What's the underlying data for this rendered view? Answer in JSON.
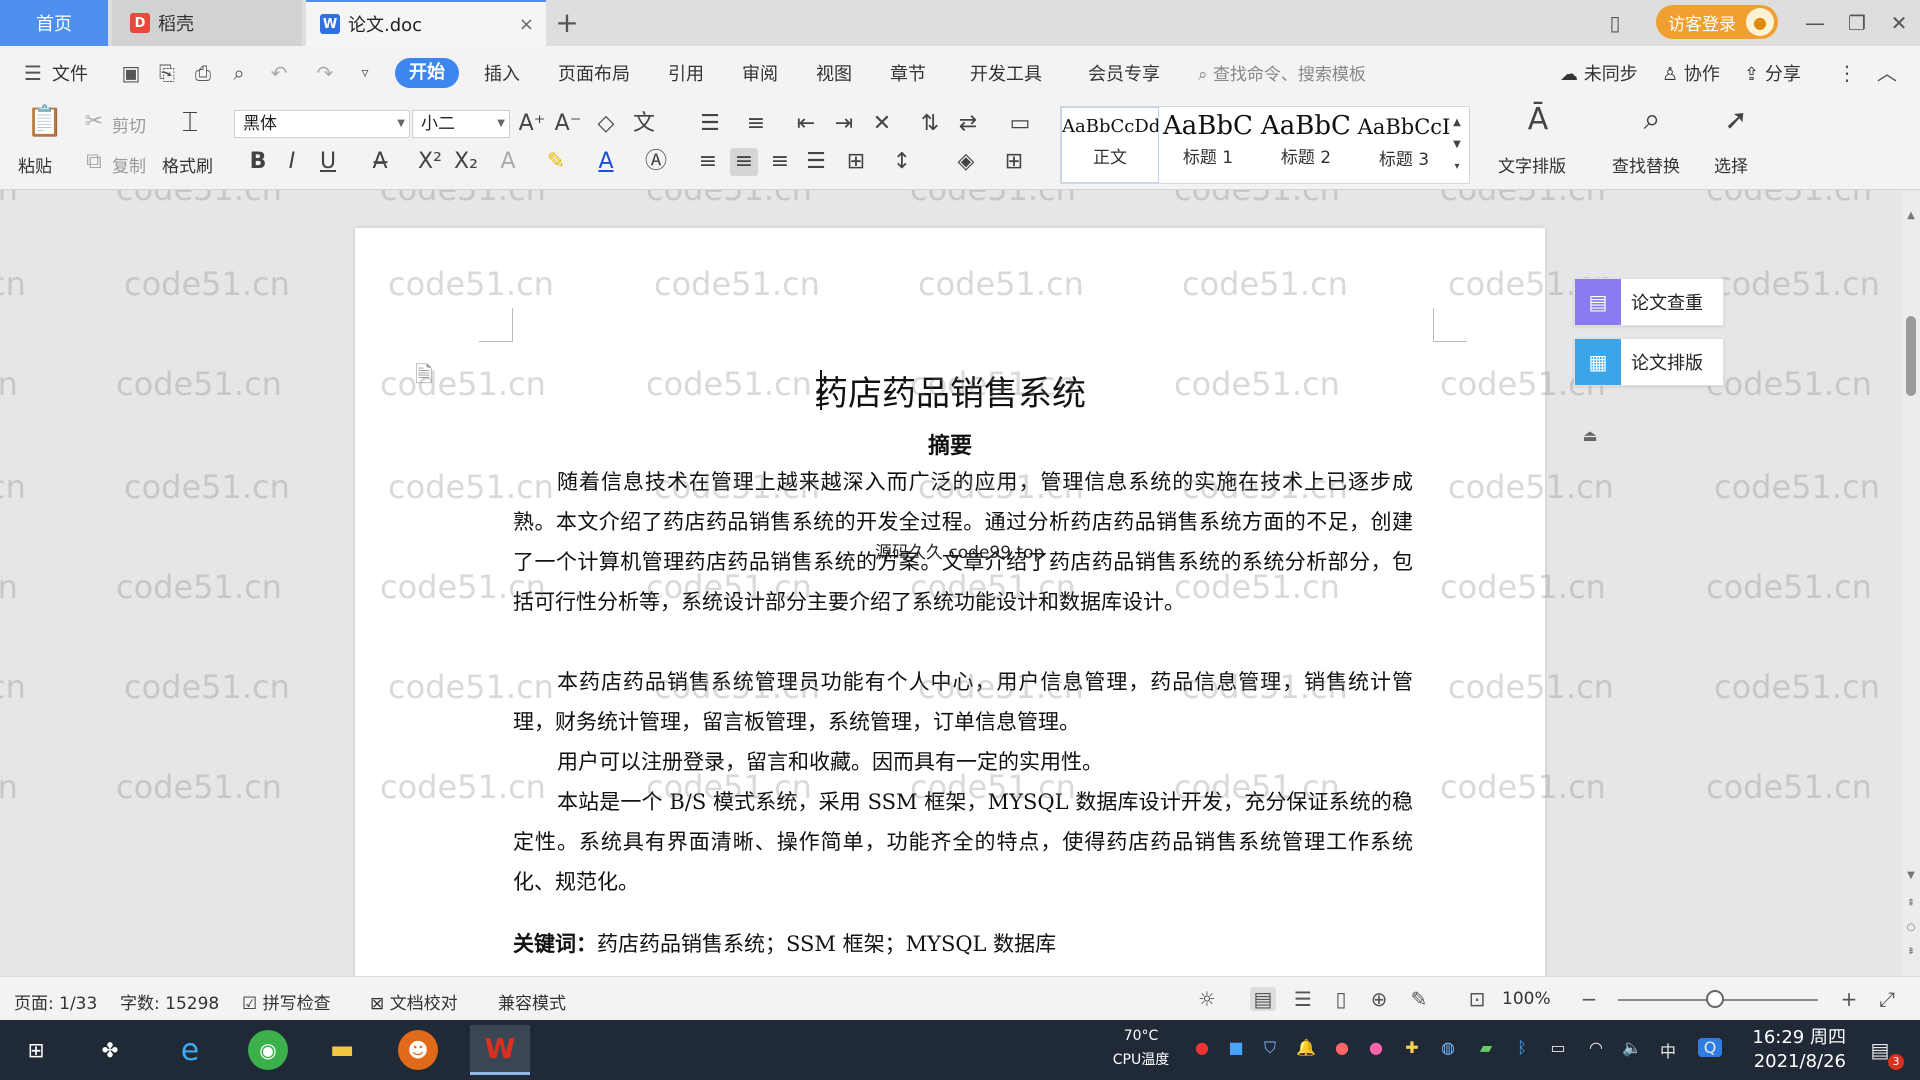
{
  "tabs": {
    "home": "首页",
    "daoke": "稻壳",
    "doc": "论文.doc",
    "add": "+",
    "close": "×"
  },
  "titlebar": {
    "guest_login": "访客登录",
    "minimize": "—",
    "restore": "❐",
    "close": "✕"
  },
  "menu": {
    "file": "文件",
    "start": "开始",
    "insert": "插入",
    "layout": "页面布局",
    "reference": "引用",
    "review": "审阅",
    "view": "视图",
    "chapter": "章节",
    "devtools": "开发工具",
    "vip": "会员专享",
    "search_placeholder": "查找命令、搜索模板",
    "unsynced": "未同步",
    "collab": "协作",
    "share": "分享"
  },
  "ribbon": {
    "paste": "粘贴",
    "cut": "剪切",
    "copy": "复制",
    "format_painter": "格式刷",
    "font_name": "黑体",
    "font_size": "小二",
    "styles": [
      {
        "sample": "AaBbCcDd",
        "name": "正文"
      },
      {
        "sample": "AaBbC",
        "name": "标题 1"
      },
      {
        "sample": "AaBbC",
        "name": "标题 2"
      },
      {
        "sample": "AaBbCcI",
        "name": "标题 3"
      }
    ],
    "text_layout": "文字排版",
    "find_replace": "查找替换",
    "select": "选择"
  },
  "document": {
    "title": "药店药品销售系统",
    "abstract_heading": "摘要",
    "paragraphs": [
      "随着信息技术在管理上越来越深入而广泛的应用，管理信息系统的实施在技术上已逐步成熟。本文介绍了药店药品销售系统的开发全过程。通过分析药店药品销售系统方面的不足，创建了一个计算机管理药店药品销售系统的方案。文章介绍了药店药品销售系统的系统分析部分，包括可行性分析等，系统设计部分主要介绍了系统功能设计和数据库设计。",
      "本药店药品销售系统管理员功能有个人中心，用户信息管理，药品信息管理，销售统计管理，财务统计管理，留言板管理，系统管理，订单信息管理。",
      "用户可以注册登录，留言和收藏。因而具有一定的实用性。",
      "本站是一个 B/S 模式系统，采用 SSM 框架，MYSQL 数据库设计开发，充分保证系统的稳定性。系统具有界面清晰、操作简单，功能齐全的特点，使得药店药品销售系统管理工作系统化、规范化。"
    ],
    "keywords_label": "关键词：",
    "keywords": "药店药品销售系统；SSM 框架；MYSQL 数据库",
    "overlay": "源码久久 code99.top",
    "watermark": "code51.cn"
  },
  "sidepanel": {
    "check": "论文查重",
    "layout": "论文排版"
  },
  "status": {
    "page": "页面: 1/33",
    "words": "字数: 15298",
    "spell": "拼写检查",
    "proof": "文档校对",
    "compat": "兼容模式",
    "zoom": "100%"
  },
  "taskbar": {
    "cpu_temp": "70°C",
    "cpu_label": "CPU温度",
    "ime": "中",
    "time": "16:29 周四",
    "date": "2021/8/26",
    "notify_count": "3"
  },
  "colors": {
    "accent": "#3c86f0",
    "guest": "#f0a030",
    "wps_red": "#d9301f"
  }
}
